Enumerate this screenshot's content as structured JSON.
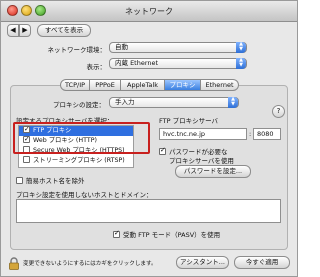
{
  "window": {
    "title": "ネットワーク"
  },
  "toolbar": {
    "back": "◀",
    "forward": "▶",
    "show_all": "すべてを表示"
  },
  "form": {
    "environment_label": "ネットワーク環境：",
    "environment_value": "自動",
    "display_label": "表示：",
    "display_value": "内蔵 Ethernet"
  },
  "tabs": [
    {
      "label": "TCP/IP",
      "active": false
    },
    {
      "label": "PPPoE",
      "active": false
    },
    {
      "label": "AppleTalk",
      "active": false
    },
    {
      "label": "プロキシ",
      "active": true
    },
    {
      "label": "Ethernet",
      "active": false
    }
  ],
  "proxy": {
    "setting_label": "プロキシの設定：",
    "setting_value": "手入力",
    "select_label": "設定するプロキシサーバを選択：",
    "list": [
      {
        "label": "FTP プロキシ",
        "checked": true,
        "selected": true
      },
      {
        "label": "Web プロキシ (HTTP)",
        "checked": true,
        "selected": false
      },
      {
        "label": "Secure Web プロキシ (HTTPS)",
        "checked": false,
        "selected": false
      },
      {
        "label": "ストリーミングプロキシ (RTSP)",
        "checked": false,
        "selected": false
      }
    ],
    "server_title": "FTP プロキシサーバ",
    "server_value": "hvc.tnc.ne.jp",
    "port_value": "8080",
    "password_required": "パスワードが必要な",
    "password_required_2": "プロキシサーバを使用",
    "password_button": "パスワードを設定...",
    "simple_hostnames": "簡易ホスト名を除外",
    "bypass_label": "プロキシ設定を使用しないホストとドメイン：",
    "passive_ftp": "受動 FTP モード（PASV）を使用"
  },
  "footer": {
    "lock_text": "変更できないようにするにはカギをクリックします。",
    "assistant_button": "アシスタント...",
    "apply_button": "今すぐ適用"
  },
  "icons": {
    "lock": "lock-icon",
    "help": "help-icon"
  }
}
